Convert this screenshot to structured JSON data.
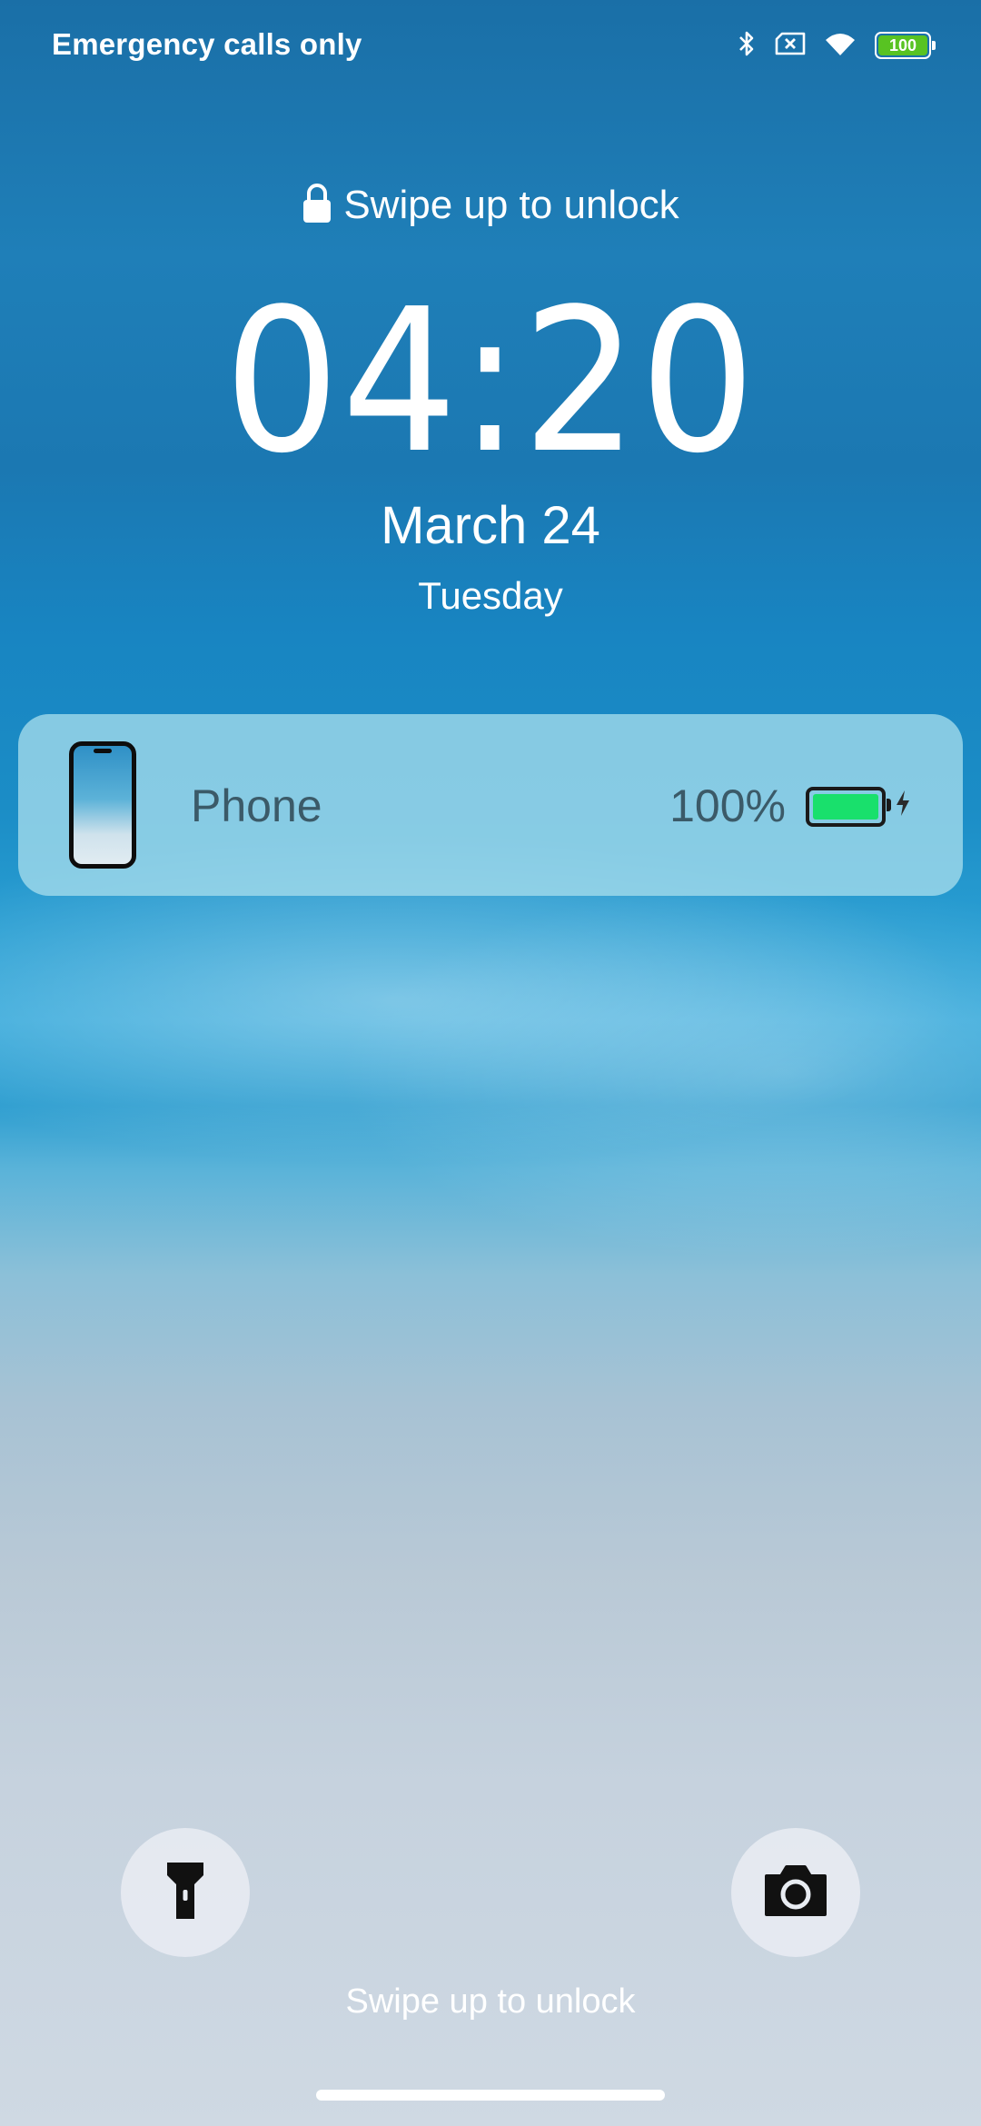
{
  "status_bar": {
    "carrier_text": "Emergency calls only",
    "icons": [
      "bluetooth-icon",
      "no-sim-icon",
      "wifi-icon",
      "battery-icon"
    ],
    "battery_level": "100",
    "battery_color": "#58c322"
  },
  "lockscreen": {
    "top_hint": "Swipe up to unlock",
    "time": "04:20",
    "date": "March 24",
    "day": "Tuesday",
    "bottom_hint": "Swipe up to unlock"
  },
  "battery_card": {
    "device_name": "Phone",
    "percent_text": "100%",
    "charge_fraction": 1.0,
    "charging": true,
    "battery_color": "#19e06c"
  },
  "shortcuts": {
    "left_icon": "flashlight-icon",
    "right_icon": "camera-icon"
  }
}
